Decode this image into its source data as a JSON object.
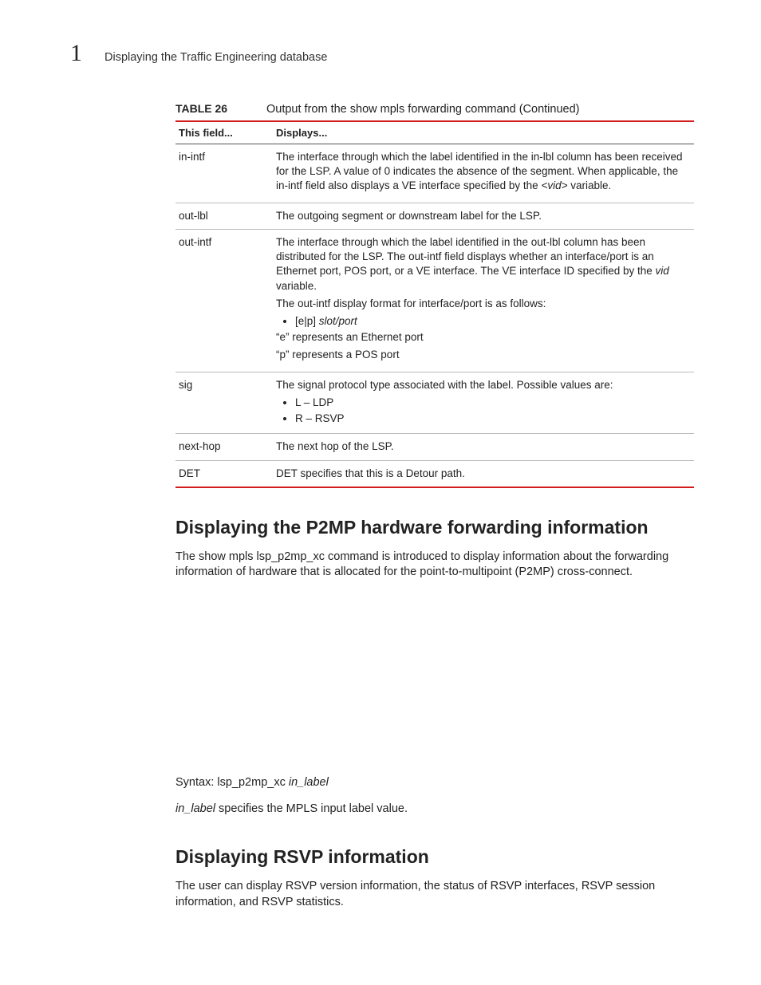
{
  "header": {
    "page_number": "1",
    "running_title": "Displaying the Traffic Engineering database"
  },
  "table": {
    "label": "TABLE 26",
    "caption": "Output from the show mpls forwarding command  (Continued)",
    "head": {
      "col1": "This field...",
      "col2": "Displays..."
    },
    "rows": [
      {
        "field": "in-intf",
        "desc_parts": {
          "p1a": "The interface through which the label identified in the in-lbl column has been received for the LSP. A value of 0 indicates the absence of the segment. When applicable, the in-intf field also displays a VE interface specified by the ",
          "p1b": "<vid>",
          "p1c": " variable."
        }
      },
      {
        "field": "out-lbl",
        "desc": "The outgoing segment or downstream label for the LSP."
      },
      {
        "field": "out-intf",
        "desc_parts": {
          "p1a": "The interface through which the label identified in the out-lbl column has been distributed for the LSP. The out-intf field displays whether an interface/port is an Ethernet port, POS port, or a VE interface. The VE interface ID specified by the ",
          "p1b": "vid",
          "p1c": " variable.",
          "p2": "The out-intf display format for interface/port is as follows:",
          "bullet1a": "[e|p] ",
          "bullet1b": "slot/port",
          "p3": "“e” represents an Ethernet port",
          "p4": "“p” represents a POS port"
        }
      },
      {
        "field": "sig",
        "desc_parts": {
          "p1": "The signal protocol type associated with the label. Possible values are:",
          "bullet1": "L – LDP",
          "bullet2": "R – RSVP"
        }
      },
      {
        "field": "next-hop",
        "desc": "The next hop of the LSP."
      },
      {
        "field": "DET",
        "desc": "DET specifies that this is a Detour path."
      }
    ]
  },
  "sections": {
    "p2mp": {
      "heading": "Displaying the P2MP hardware forwarding information",
      "para1": "The show mpls lsp_p2mp_xc command is introduced to display information about the forwarding information of hardware that is allocated for the point-to-multipoint (P2MP) cross-connect.",
      "syntax_prefix": "Syntax:  lsp_p2mp_xc ",
      "syntax_arg": "in_label",
      "para2_a": "in_label",
      "para2_b": " specifies the MPLS input label value."
    },
    "rsvp": {
      "heading": "Displaying RSVP information",
      "para1": "The user can display RSVP version information, the status of RSVP interfaces, RSVP session information, and RSVP statistics."
    }
  }
}
